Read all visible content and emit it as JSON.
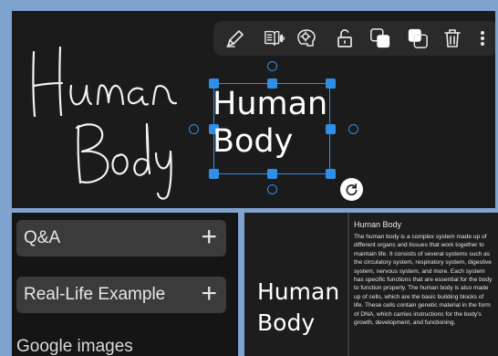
{
  "canvas": {
    "handwritten_text": "Human Body",
    "typed_text_line1": "Human",
    "typed_text_line2": "Body",
    "toolbar": {
      "icons": [
        "pen-icon",
        "read-aloud-icon",
        "ai-brain-icon",
        "unlock-icon",
        "bring-forward-icon",
        "send-backward-icon",
        "trash-icon",
        "more-vert-icon"
      ]
    },
    "colors": {
      "selection": "#2f8ee6",
      "background": "#1b1b1b",
      "page": "#7fa3cf"
    }
  },
  "options": {
    "items": [
      {
        "label": "Q&A",
        "icon": "plus-icon"
      },
      {
        "label": "Real-Life Example",
        "icon": "plus-icon"
      }
    ],
    "section": "Google images"
  },
  "note": {
    "title_line1": "Human",
    "title_line2": "Body",
    "heading": "Human Body",
    "body": "The human body is a complex system made up of different organs and tissues that work together to maintain life. It consists of several systems such as the circulatory system, respiratory system, digestive system, nervous system, and more. Each system has specific functions that are essential for the body to function properly. The human body is also made up of cells, which are the basic building blocks of life. These cells contain genetic material in the form of DNA, which carries instructions for the body's growth, development, and functioning."
  }
}
